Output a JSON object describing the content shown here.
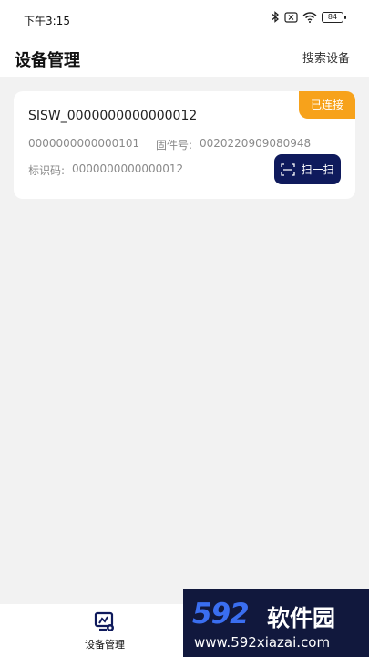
{
  "status_bar": {
    "time": "下午3:15",
    "battery": "84"
  },
  "header": {
    "title": "设备管理",
    "search_label": "搜索设备"
  },
  "device": {
    "name": "SISW_0000000000000012",
    "status": "已连接",
    "serial": "0000000000000101",
    "firmware_label": "固件号:",
    "firmware_value": "0020220909080948",
    "id_label": "标识码:",
    "id_value": "0000000000000012",
    "scan_label": "扫一扫"
  },
  "bottom_nav": {
    "items": [
      {
        "label": "设备管理",
        "icon": "device-manage-icon"
      }
    ]
  },
  "watermark": {
    "logo": "592",
    "brand": "软件园",
    "url": "www.592xiazai.com"
  },
  "colors": {
    "accent": "#0f1a5c",
    "badge": "#f7a21b",
    "background": "#f2f2f2"
  }
}
